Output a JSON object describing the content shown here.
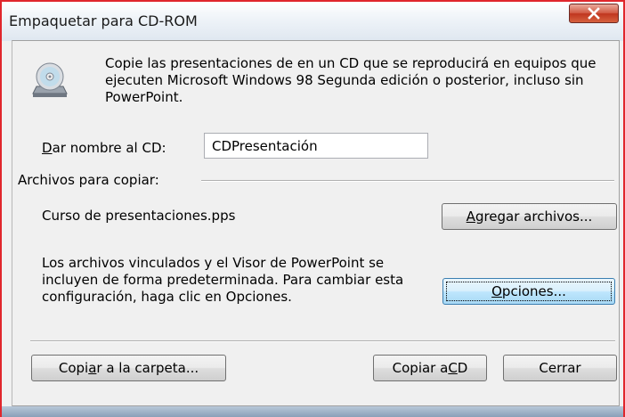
{
  "window": {
    "title": "Empaquetar para CD-ROM",
    "close_icon": "close-x-icon"
  },
  "intro": {
    "icon": "cd-drive-icon",
    "text": "Copie las presentaciones de en un CD que se reproducirá en equipos que ejecuten Microsoft Windows 98 Segunda edición o posterior, incluso sin PowerPoint."
  },
  "cd_name": {
    "label_prefix": "D",
    "label_rest": "ar nombre al CD:",
    "value": "CDPresentación"
  },
  "files": {
    "group_label": "Archivos para copiar:",
    "items": [
      "Curso de presentaciones.pps"
    ],
    "add_button_prefix": "A",
    "add_button_rest": "gregar archivos..."
  },
  "linked": {
    "text": "Los archivos vinculados y el Visor de PowerPoint se incluyen de forma predeterminada. Para cambiar esta configuración, haga clic en Opciones.",
    "options_button_prefix": "O",
    "options_button_rest": "pciones..."
  },
  "footer": {
    "copy_folder_pre": "Copi",
    "copy_folder_ul": "a",
    "copy_folder_post": "r a la carpeta...",
    "copy_cd_pre": "Copiar a ",
    "copy_cd_ul": "C",
    "copy_cd_post": "D",
    "close_label": "Cerrar"
  }
}
